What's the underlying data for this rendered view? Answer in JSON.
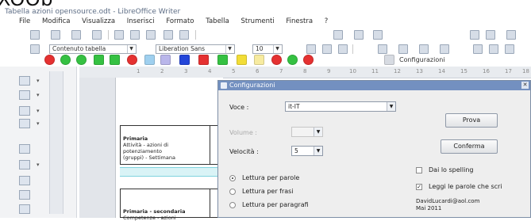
{
  "window": {
    "fragment_text": "XOOb",
    "title": "Tabella azioni opensource.odt - LibreOffice Writer"
  },
  "menu": [
    "File",
    "Modifica",
    "Visualizza",
    "Inserisci",
    "Formato",
    "Tabella",
    "Strumenti",
    "Finestra",
    "?"
  ],
  "toolbar": {
    "style_value": "Contenuto tabella",
    "font_value": "Liberation Sans",
    "size_value": "10",
    "config_label": "Configurazioni"
  },
  "ruler_ticks": [
    "1",
    "2",
    "3",
    "4",
    "5",
    "6",
    "7",
    "8",
    "9",
    "10",
    "11",
    "12",
    "13",
    "14",
    "15",
    "16",
    "17",
    "18"
  ],
  "document": {
    "cell1_title": "Primaria",
    "cell1_line1": "Attività - azioni di",
    "cell1_line2": "potenziamento",
    "cell1_line3": "(gruppi) - Settimana",
    "cell2_title": "Primaria - secondaria",
    "cell2_line1": "Competenze - azioni"
  },
  "dialog": {
    "title": "Configurazioni",
    "voce_label": "Voce :",
    "voce_value": "it-IT",
    "volume_label": "Volume :",
    "velocita_label": "Velocità :",
    "velocita_value": "5",
    "prova_label": "Prova",
    "conferma_label": "Conferma",
    "radio_parole": "Lettura per parole",
    "radio_frasi": "Lettura per frasi",
    "radio_paragrafi": "Lettura per paragrafi",
    "check_spelling": "Dai lo spelling",
    "check_leggi": "Leggi le parole che scri",
    "author": "DavidLucardi@aol.com",
    "date": "Mai 2011"
  },
  "colors": {
    "accent": "#7390c0",
    "red": "#e53131",
    "green": "#35c142",
    "blue": "#2446d9",
    "yellow": "#f2dd37"
  },
  "icons": [
    "new-icon",
    "open-icon",
    "save-icon",
    "print-icon",
    "cut-icon",
    "copy-icon",
    "paste-icon",
    "undo-icon",
    "redo-icon",
    "bold-icon",
    "italic-icon",
    "underline-icon",
    "align-left-icon",
    "align-center-icon",
    "align-right-icon",
    "arrow-up-icon",
    "arrow-down-icon",
    "cancel-icon",
    "config-icon"
  ]
}
